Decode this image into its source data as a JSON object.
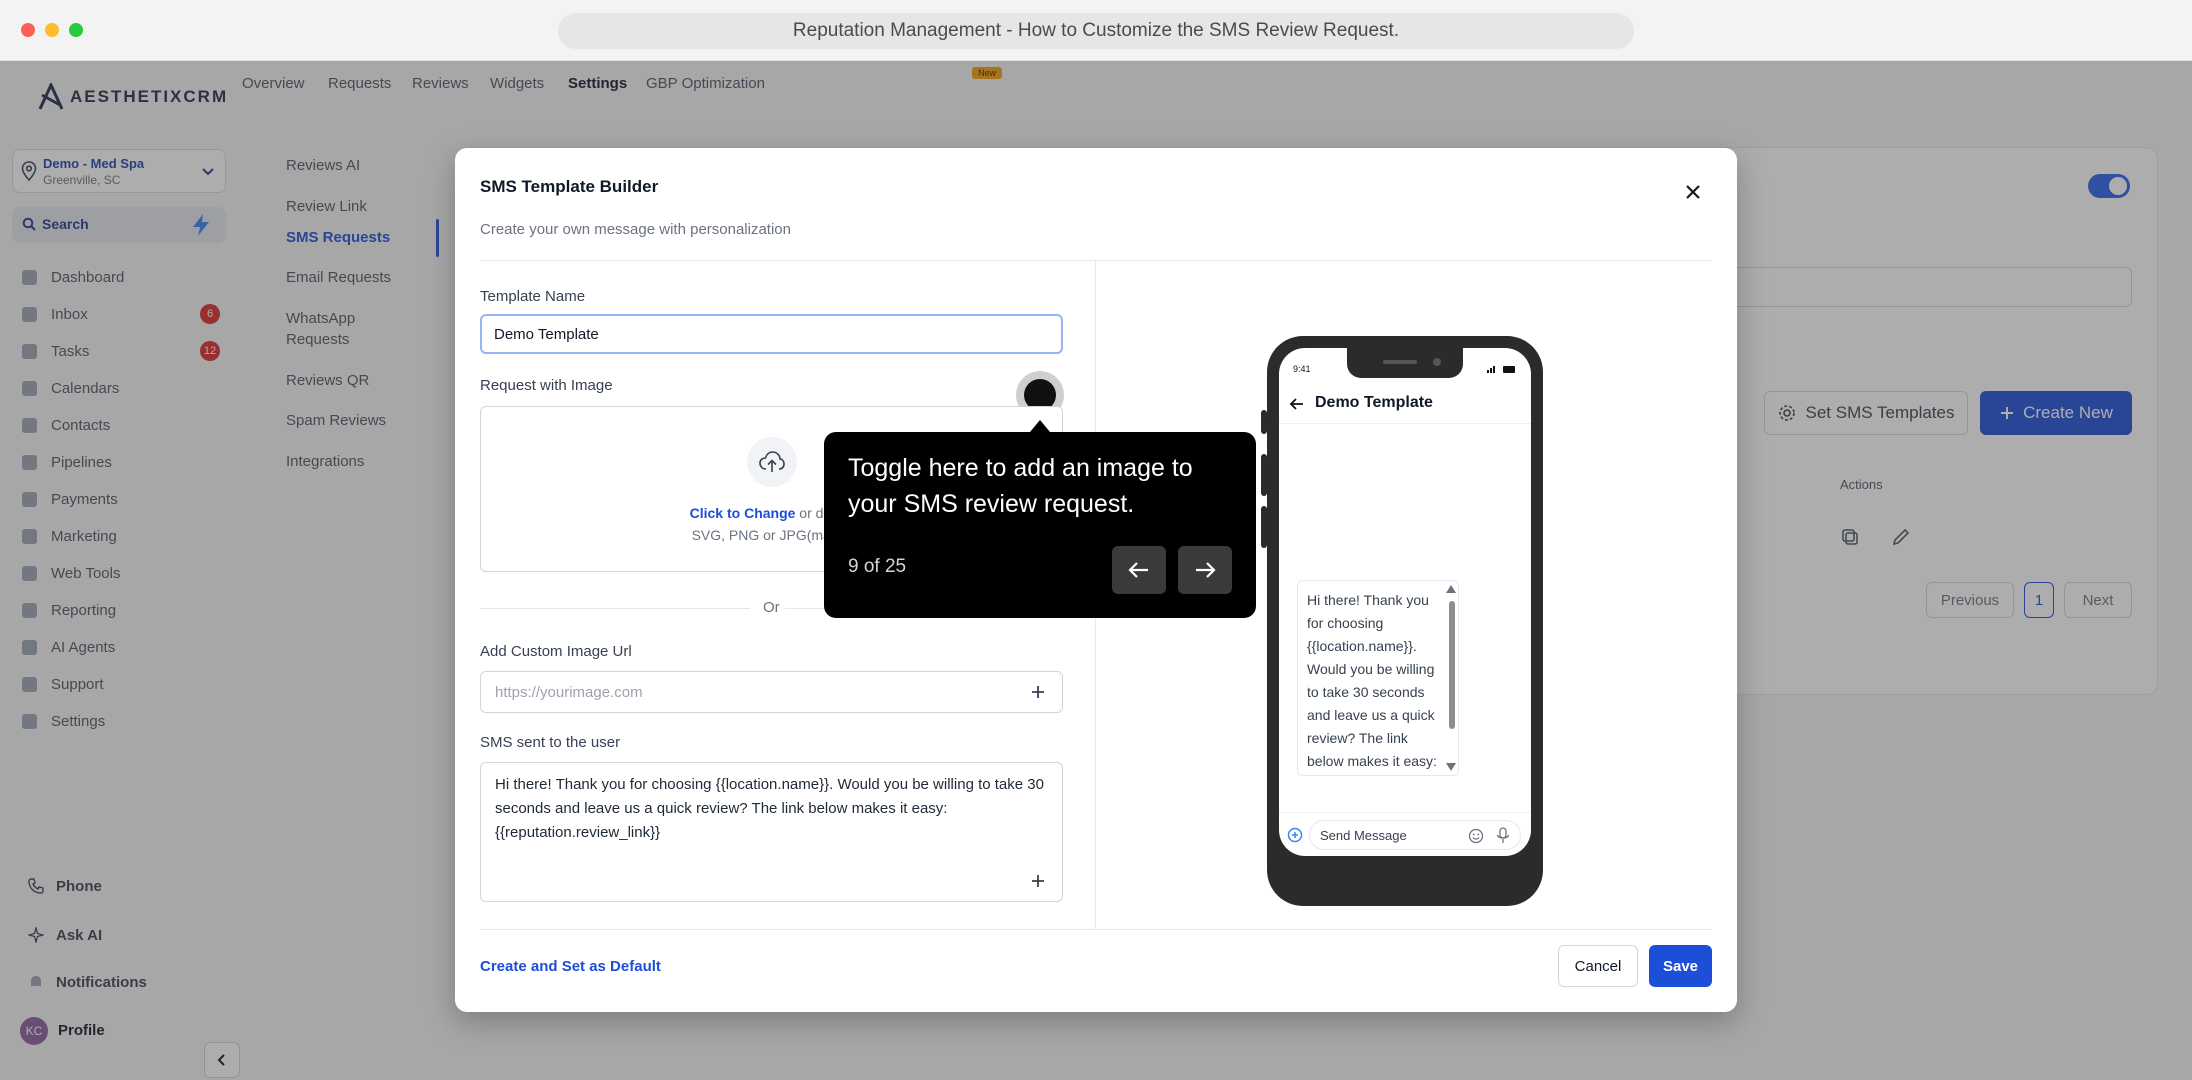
{
  "browser": {
    "title": "Reputation Management - How to Customize the SMS Review Request."
  },
  "brand": {
    "logo_text": "AESTHETIXCRM"
  },
  "location": {
    "name": "Demo - Med Spa",
    "city": "Greenville, SC"
  },
  "search": {
    "label": "Search"
  },
  "sidebar": {
    "items": [
      {
        "label": "Dashboard"
      },
      {
        "label": "Inbox",
        "badge": "6"
      },
      {
        "label": "Tasks",
        "badge": "12"
      },
      {
        "label": "Calendars"
      },
      {
        "label": "Contacts"
      },
      {
        "label": "Pipelines"
      },
      {
        "label": "Payments"
      },
      {
        "label": "Marketing"
      },
      {
        "label": "Web Tools"
      },
      {
        "label": "Reporting"
      },
      {
        "label": "AI Agents"
      },
      {
        "label": "Support"
      },
      {
        "label": "Settings"
      }
    ],
    "bottom": {
      "phone": "Phone",
      "ask_ai": "Ask AI",
      "notifications": "Notifications",
      "profile": "Profile",
      "avatar_initials": "KC"
    }
  },
  "tabs": {
    "overview": "Overview",
    "requests": "Requests",
    "reviews": "Reviews",
    "widgets": "Widgets",
    "settings": "Settings",
    "gbp": "GBP Optimization",
    "new_badge": "New"
  },
  "submenu": {
    "reviews_ai": "Reviews AI",
    "review_link": "Review Link",
    "sms_requests": "SMS Requests",
    "email_requests": "Email Requests",
    "whatsapp_1": "WhatsApp",
    "whatsapp_2": "Requests",
    "reviews_qr": "Reviews QR",
    "spam_reviews": "Spam Reviews",
    "integrations": "Integrations"
  },
  "background": {
    "set_templates": "Set SMS Templates",
    "create_new": "Create New",
    "actions_header": "Actions",
    "previous": "Previous",
    "page": "1",
    "next": "Next"
  },
  "modal": {
    "title": "SMS Template Builder",
    "subtitle": "Create your own message with personalization",
    "template_name_label": "Template Name",
    "template_name_value": "Demo Template",
    "request_image_label": "Request with Image",
    "upload_link": "Click to Change",
    "upload_text": " or drag a",
    "upload_hint": "SVG, PNG or JPG(max. 1",
    "or_label": "Or",
    "custom_url_label": "Add Custom Image Url",
    "custom_url_placeholder": "https://yourimage.com",
    "sms_label": "SMS sent to the user",
    "sms_text": "Hi there! Thank you for choosing {{location.name}}. Would you be willing to take 30 seconds and leave us a quick review? The link below makes it easy: {{reputation.review_link}}",
    "create_default": "Create and Set as Default",
    "cancel": "Cancel",
    "save": "Save"
  },
  "phone": {
    "time": "9:41",
    "title": "Demo Template",
    "bubble_text": "Hi there! Thank you for choosing {{location.name}}. Would you be willing to take 30 seconds and leave us a quick review? The link below makes it easy:",
    "message_placeholder": "Send Message"
  },
  "tooltip": {
    "text": "Toggle here to add an image to your SMS review request.",
    "step": "9 of 25"
  }
}
